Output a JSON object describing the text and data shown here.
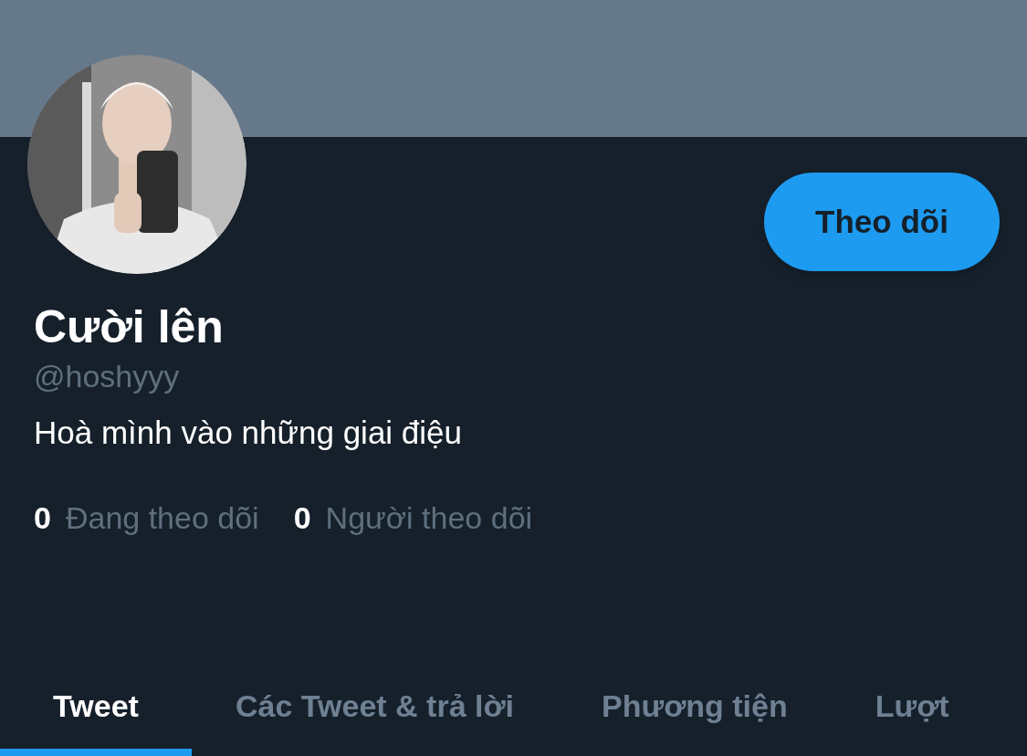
{
  "profile": {
    "name": "Cười lên",
    "handle": "@hoshyyy",
    "bio": "Hoà mình vào những giai điệu"
  },
  "follow_button": {
    "label": "Theo dõi"
  },
  "stats": [
    {
      "count": "0",
      "label": "Đang theo dõi"
    },
    {
      "count": "0",
      "label": "Người theo dõi"
    }
  ],
  "tabs": [
    {
      "label": "Tweet",
      "selected": true
    },
    {
      "label": "Các Tweet & trả lời",
      "selected": false
    },
    {
      "label": "Phương tiện",
      "selected": false
    },
    {
      "label": "Lượt",
      "selected": false
    }
  ]
}
